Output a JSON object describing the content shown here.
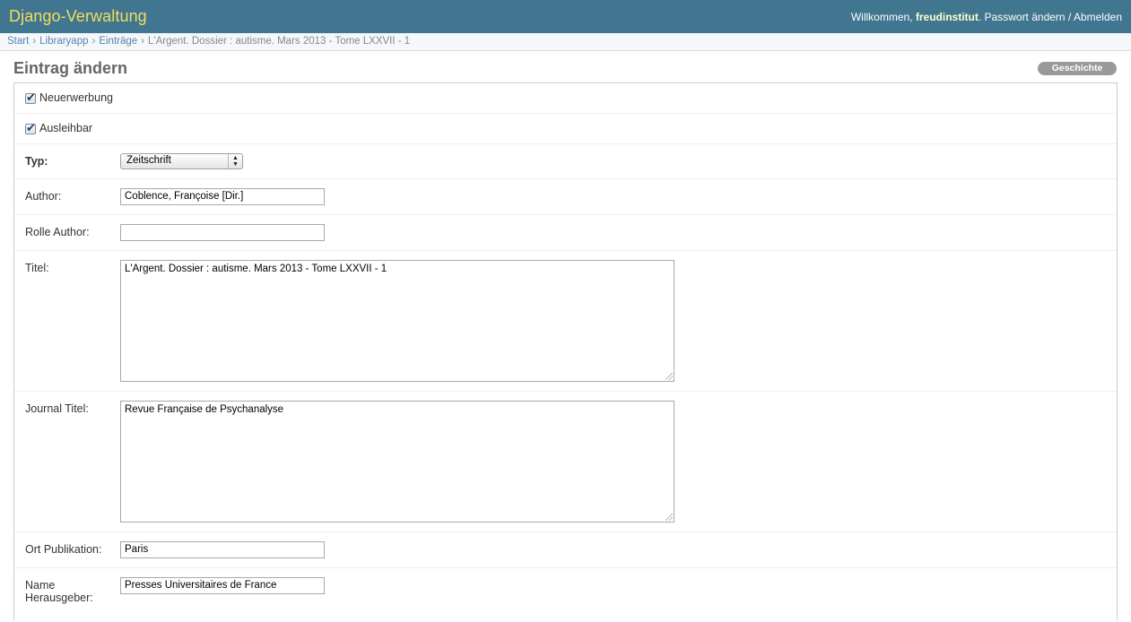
{
  "header": {
    "branding": "Django-Verwaltung",
    "welcome": "Willkommen,",
    "username": "freudinstitut",
    "period": ".",
    "password_change": "Passwort ändern",
    "separator": "/",
    "logout": "Abmelden"
  },
  "breadcrumbs": {
    "items": [
      "Start",
      "Libraryapp",
      "Einträge"
    ],
    "current": "L'Argent. Dossier : autisme. Mars 2013 - Tome LXXVII - 1",
    "separator": "›"
  },
  "page": {
    "title": "Eintrag ändern",
    "history_button": "Geschichte"
  },
  "form": {
    "neuerwerbung": {
      "label": "Neuerwerbung",
      "checked": true
    },
    "ausleihbar": {
      "label": "Ausleihbar",
      "checked": true
    },
    "typ": {
      "label": "Typ:",
      "value": "Zeitschrift"
    },
    "author": {
      "label": "Author:",
      "value": "Coblence, Françoise [Dir.]"
    },
    "rolle_author": {
      "label": "Rolle Author:",
      "value": ""
    },
    "titel": {
      "label": "Titel:",
      "value": "L'Argent. Dossier : autisme. Mars 2013 - Tome LXXVII - 1"
    },
    "journal_titel": {
      "label": "Journal Titel:",
      "value": "Revue Française de Psychanalyse"
    },
    "ort_publikation": {
      "label": "Ort Publikation:",
      "value": "Paris"
    },
    "name_herausgeber": {
      "label": "Name Herausgeber:",
      "value": "Presses Universitaires de France"
    }
  },
  "icons": {
    "checkbox_checked": "check-icon",
    "select_arrows": "updown-arrows-icon",
    "resize": "resize-grip-icon"
  },
  "colors": {
    "header_bg": "#417690",
    "branding": "#f5dd5d",
    "link": "#5b80b2",
    "history_btn": "#999999"
  }
}
